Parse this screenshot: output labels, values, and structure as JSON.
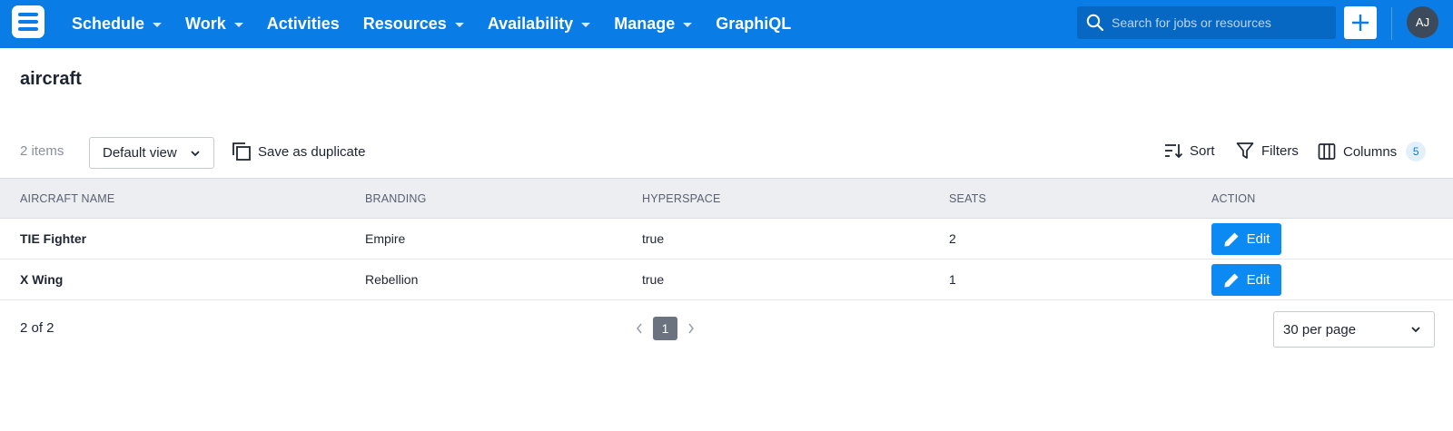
{
  "nav": {
    "items": [
      {
        "label": "Schedule",
        "dropdown": true
      },
      {
        "label": "Work",
        "dropdown": true
      },
      {
        "label": "Activities",
        "dropdown": false
      },
      {
        "label": "Resources",
        "dropdown": true
      },
      {
        "label": "Availability",
        "dropdown": true
      },
      {
        "label": "Manage",
        "dropdown": true
      },
      {
        "label": "GraphiQL",
        "dropdown": false
      }
    ],
    "search_placeholder": "Search for jobs or resources",
    "avatar_initials": "AJ",
    "brand_color": "#0a7ce6"
  },
  "page": {
    "title": "aircraft"
  },
  "toolbar": {
    "item_count": "2 items",
    "view_select": "Default view",
    "duplicate_label": "Save as duplicate",
    "sort_label": "Sort",
    "filters_label": "Filters",
    "columns_label": "Columns",
    "columns_count": "5"
  },
  "table": {
    "headers": [
      "AIRCRAFT NAME",
      "BRANDING",
      "HYPERSPACE",
      "SEATS",
      "ACTION"
    ],
    "rows": [
      {
        "name": "TIE Fighter",
        "branding": "Empire",
        "hyperspace": "true",
        "seats": "2",
        "action": "Edit"
      },
      {
        "name": "X Wing",
        "branding": "Rebellion",
        "hyperspace": "true",
        "seats": "1",
        "action": "Edit"
      }
    ]
  },
  "footer": {
    "range": "2 of 2",
    "current_page": "1",
    "per_page": "30 per page"
  }
}
